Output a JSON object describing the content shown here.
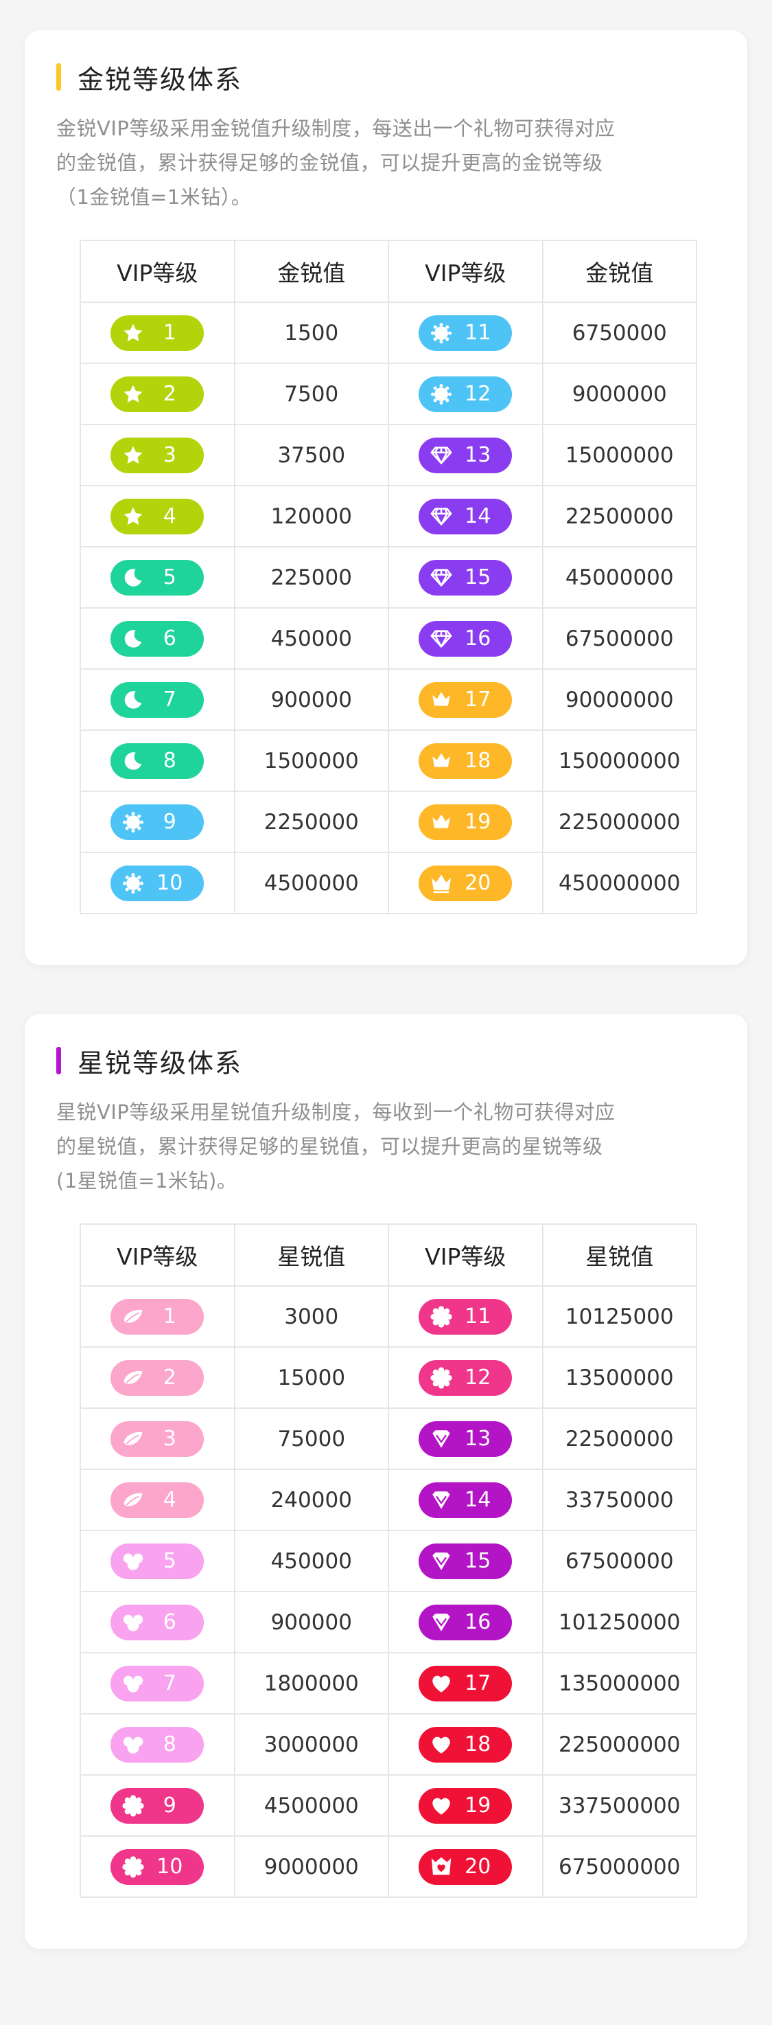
{
  "gold": {
    "title": "金锐等级体系",
    "desc_lines": [
      "金锐VIP等级采用金锐值升级制度，每送出一个礼物可获得对应",
      "的金锐值，累计获得足够的金锐值，可以提升更高的金锐等级",
      "（1金锐值=1米钻）。"
    ],
    "headers": [
      "VIP等级",
      "金锐值",
      "VIP等级",
      "金锐值"
    ],
    "rows": [
      {
        "l_level": "1",
        "l_value": "1500",
        "l_icon": "star-icon",
        "l_color": "#b3d40a",
        "r_level": "11",
        "r_value": "6750000",
        "r_icon": "sun-icon",
        "r_color": "#4ec3f5"
      },
      {
        "l_level": "2",
        "l_value": "7500",
        "l_icon": "star-icon",
        "l_color": "#b3d40a",
        "r_level": "12",
        "r_value": "9000000",
        "r_icon": "sun-icon",
        "r_color": "#4ec3f5"
      },
      {
        "l_level": "3",
        "l_value": "37500",
        "l_icon": "star-icon",
        "l_color": "#b3d40a",
        "r_level": "13",
        "r_value": "15000000",
        "r_icon": "diamond-icon",
        "r_color": "#8a3df0"
      },
      {
        "l_level": "4",
        "l_value": "120000",
        "l_icon": "star-icon",
        "l_color": "#b3d40a",
        "r_level": "14",
        "r_value": "22500000",
        "r_icon": "diamond-icon",
        "r_color": "#8a3df0"
      },
      {
        "l_level": "5",
        "l_value": "225000",
        "l_icon": "moon-icon",
        "l_color": "#1fd49a",
        "r_level": "15",
        "r_value": "45000000",
        "r_icon": "diamond-icon",
        "r_color": "#8a3df0"
      },
      {
        "l_level": "6",
        "l_value": "450000",
        "l_icon": "moon-icon",
        "l_color": "#1fd49a",
        "r_level": "16",
        "r_value": "67500000",
        "r_icon": "diamond-icon",
        "r_color": "#8a3df0"
      },
      {
        "l_level": "7",
        "l_value": "900000",
        "l_icon": "moon-icon",
        "l_color": "#1fd49a",
        "r_level": "17",
        "r_value": "90000000",
        "r_icon": "crown-icon",
        "r_color": "#fdb727"
      },
      {
        "l_level": "8",
        "l_value": "1500000",
        "l_icon": "moon-icon",
        "l_color": "#1fd49a",
        "r_level": "18",
        "r_value": "150000000",
        "r_icon": "crown-icon",
        "r_color": "#fdb727"
      },
      {
        "l_level": "9",
        "l_value": "2250000",
        "l_icon": "sun-icon",
        "l_color": "#4ec3f5",
        "r_level": "19",
        "r_value": "225000000",
        "r_icon": "crown-icon",
        "r_color": "#fdb727"
      },
      {
        "l_level": "10",
        "l_value": "4500000",
        "l_icon": "sun-icon",
        "l_color": "#4ec3f5",
        "r_level": "20",
        "r_value": "450000000",
        "r_icon": "big-crown-icon",
        "r_color": "#fdb727"
      }
    ]
  },
  "star": {
    "title": "星锐等级体系",
    "desc_lines": [
      "星锐VIP等级采用星锐值升级制度，每收到一个礼物可获得对应",
      "的星锐值，累计获得足够的星锐值，可以提升更高的星锐等级",
      "(1星锐值=1米钻)。"
    ],
    "headers": [
      "VIP等级",
      "星锐值",
      "VIP等级",
      "星锐值"
    ],
    "rows": [
      {
        "l_level": "1",
        "l_value": "3000",
        "l_icon": "petal-icon",
        "l_color": "#fca6cb",
        "r_level": "11",
        "r_value": "10125000",
        "r_icon": "flower-icon",
        "r_color": "#f0368a"
      },
      {
        "l_level": "2",
        "l_value": "15000",
        "l_icon": "petal-icon",
        "l_color": "#fca6cb",
        "r_level": "12",
        "r_value": "13500000",
        "r_icon": "flower-icon",
        "r_color": "#f0368a"
      },
      {
        "l_level": "3",
        "l_value": "75000",
        "l_icon": "petal-icon",
        "l_color": "#fca6cb",
        "r_level": "13",
        "r_value": "22500000",
        "r_icon": "gem-heart-icon",
        "r_color": "#b314c6"
      },
      {
        "l_level": "4",
        "l_value": "240000",
        "l_icon": "petal-icon",
        "l_color": "#fca6cb",
        "r_level": "14",
        "r_value": "33750000",
        "r_icon": "gem-heart-icon",
        "r_color": "#b314c6"
      },
      {
        "l_level": "5",
        "l_value": "450000",
        "l_icon": "bloom-icon",
        "l_color": "#f9a2f0",
        "r_level": "15",
        "r_value": "67500000",
        "r_icon": "gem-heart-icon",
        "r_color": "#b314c6"
      },
      {
        "l_level": "6",
        "l_value": "900000",
        "l_icon": "bloom-icon",
        "l_color": "#f9a2f0",
        "r_level": "16",
        "r_value": "101250000",
        "r_icon": "gem-heart-icon",
        "r_color": "#b314c6"
      },
      {
        "l_level": "7",
        "l_value": "1800000",
        "l_icon": "bloom-icon",
        "l_color": "#f9a2f0",
        "r_level": "17",
        "r_value": "135000000",
        "r_icon": "heart-icon",
        "r_color": "#f01236"
      },
      {
        "l_level": "8",
        "l_value": "3000000",
        "l_icon": "bloom-icon",
        "l_color": "#f9a2f0",
        "r_level": "18",
        "r_value": "225000000",
        "r_icon": "heart-icon",
        "r_color": "#f01236"
      },
      {
        "l_level": "9",
        "l_value": "4500000",
        "l_icon": "flower-icon",
        "l_color": "#f0368a",
        "r_level": "19",
        "r_value": "337500000",
        "r_icon": "heart-icon",
        "r_color": "#f01236"
      },
      {
        "l_level": "10",
        "l_value": "9000000",
        "l_icon": "flower-icon",
        "l_color": "#f0368a",
        "r_level": "20",
        "r_value": "675000000",
        "r_icon": "crown-heart-icon",
        "r_color": "#f01236"
      }
    ]
  }
}
